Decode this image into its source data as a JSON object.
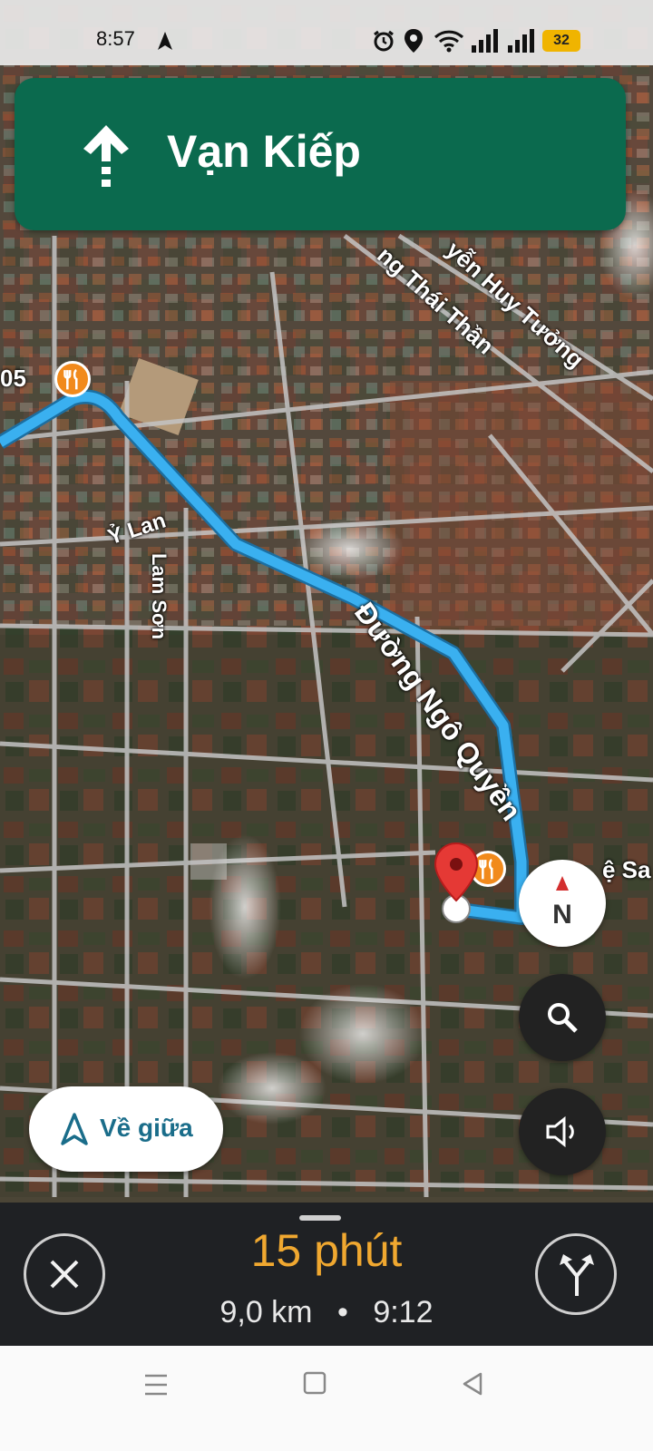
{
  "status_bar": {
    "time": "8:57",
    "battery": "32",
    "icons": [
      "navigation-arrow-icon",
      "alarm-icon",
      "location-icon",
      "wifi-icon",
      "signal-icon",
      "signal-icon"
    ]
  },
  "nav_banner": {
    "street": "Vạn Kiếp",
    "direction": "straight-arrow-icon",
    "color": "#0b6a4e"
  },
  "map": {
    "labels": {
      "top_partial": "05",
      "y_lan": "Ỷ Lan",
      "lam_son": "Lam Sơn",
      "ngo_quyen": "Đường Ngô Quyền",
      "thai_than": "ng Thái Thần",
      "huy_tuong": "yễn Huy Tưởng",
      "right_partial": "ệ Sa"
    },
    "route_color": "#3ab0f0"
  },
  "controls": {
    "compass_letter": "N",
    "recenter_label": "Về giữa"
  },
  "trip": {
    "eta_duration": "15 phút",
    "distance": "9,0 km",
    "separator": "•",
    "arrival_time": "9:12",
    "accent": "#f0a830"
  }
}
